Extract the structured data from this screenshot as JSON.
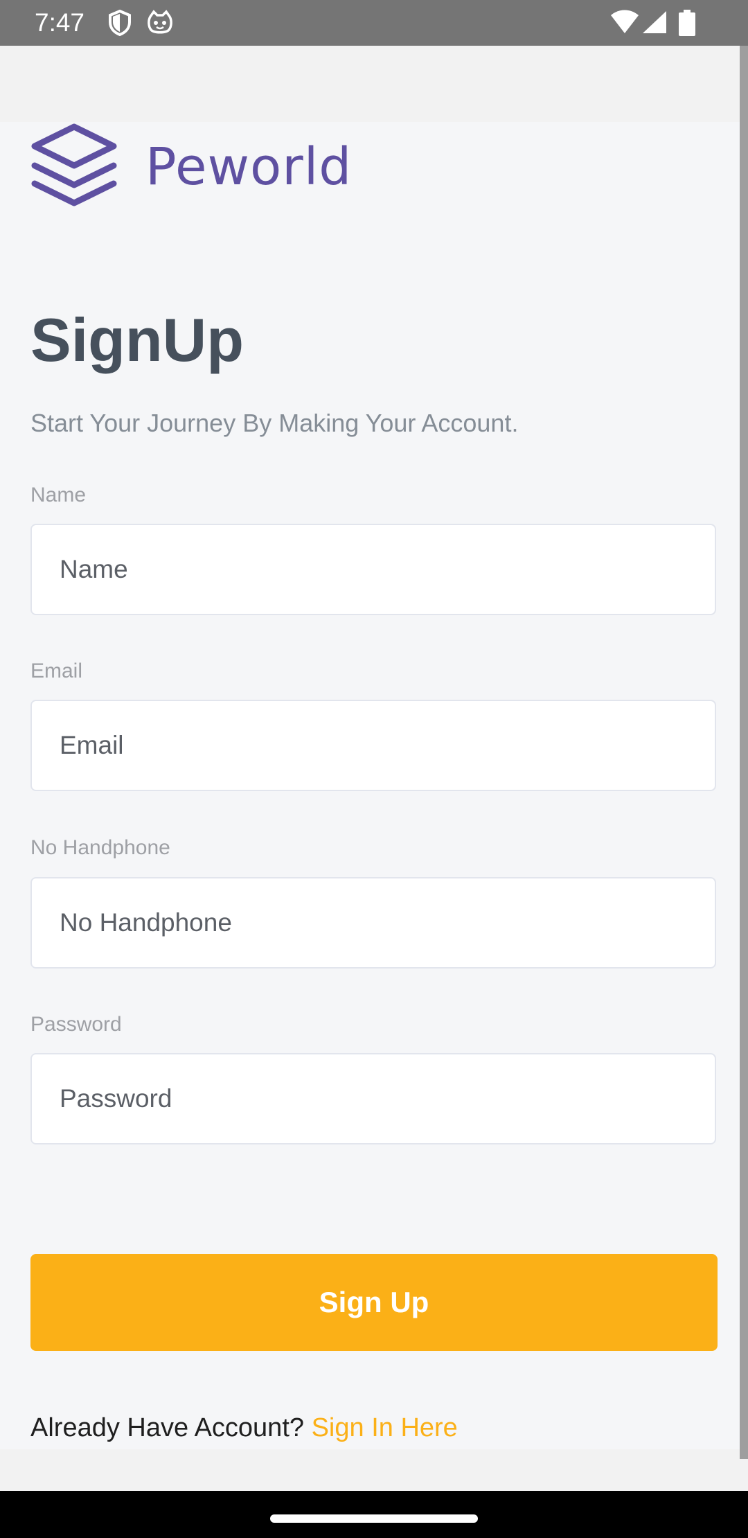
{
  "status_bar": {
    "time": "7:47",
    "icons": [
      "shield-icon",
      "cat-icon",
      "wifi-icon",
      "signal-icon",
      "battery-icon"
    ]
  },
  "brand": {
    "name": "Peworld",
    "color": "#5e50a1"
  },
  "header": {
    "title": "SignUp",
    "subtitle": "Start Your Journey By Making Your Account."
  },
  "form": {
    "name": {
      "label": "Name",
      "placeholder": "Name"
    },
    "email": {
      "label": "Email",
      "placeholder": "Email"
    },
    "phone": {
      "label": "No Handphone",
      "placeholder": "No Handphone"
    },
    "password": {
      "label": "Password",
      "placeholder": "Password"
    }
  },
  "actions": {
    "signup_label": "Sign Up",
    "button_color": "#fbb017",
    "signin_prompt": "Already Have Account? ",
    "signin_link": "Sign In Here"
  }
}
